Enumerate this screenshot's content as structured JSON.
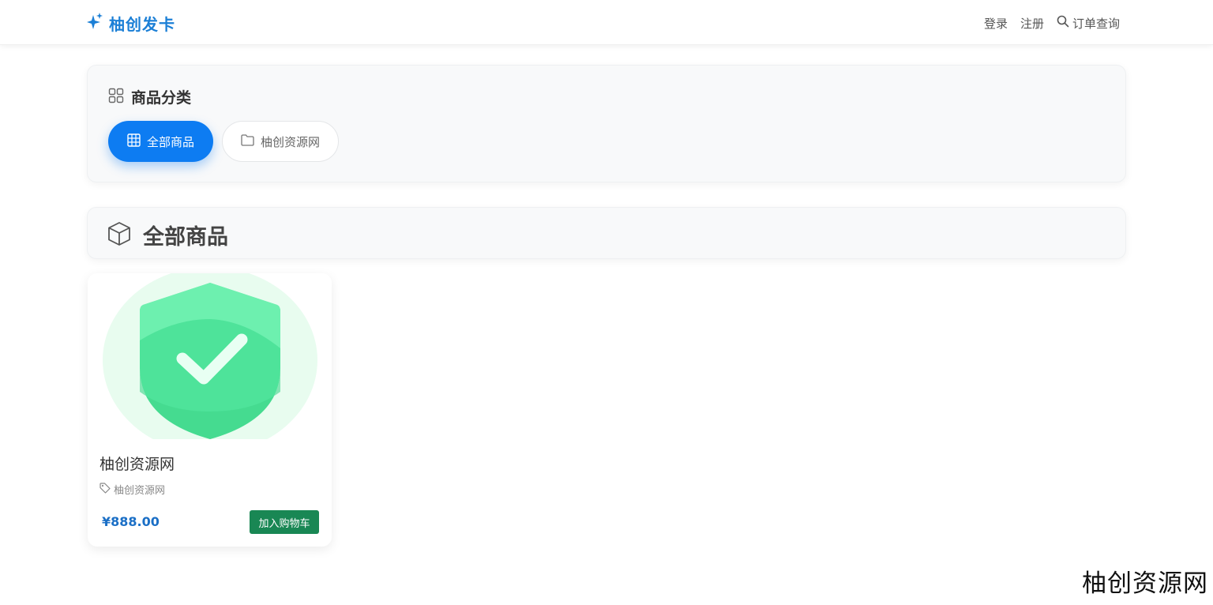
{
  "navbar": {
    "brand": "柚创发卡",
    "brand_icon": "sparkles-icon",
    "brand_color": "#1b7fd6",
    "links": {
      "login": "登录",
      "register": "注册",
      "order_query": "订单查询"
    }
  },
  "categories": {
    "title": "商品分类",
    "items": [
      {
        "label": "全部商品",
        "icon": "grid-icon",
        "active": true
      },
      {
        "label": "柚创资源网",
        "icon": "folder-icon",
        "active": false
      }
    ],
    "active_color": "#0d7cf2"
  },
  "section": {
    "title": "全部商品",
    "icon": "box-icon"
  },
  "products": [
    {
      "name": "柚创资源网",
      "category_tag": "柚创资源网",
      "price": "¥888.00",
      "cart_label": "加入购物车",
      "image_icon": "shield-check-icon"
    }
  ],
  "watermark": "柚创资源网"
}
